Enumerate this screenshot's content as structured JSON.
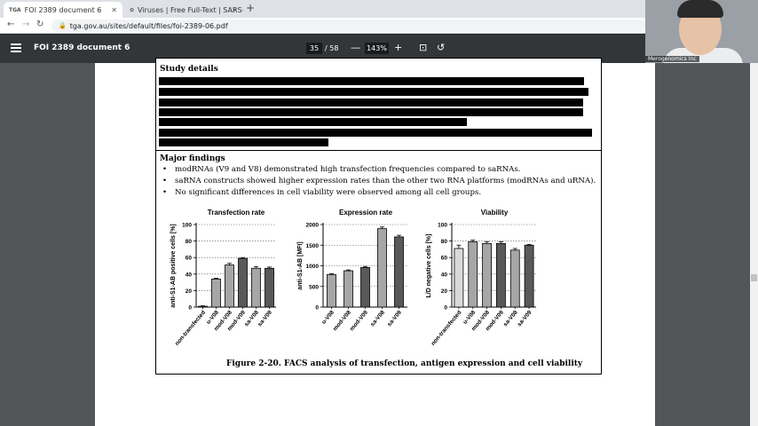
{
  "browser": {
    "tabs": [
      {
        "favicon": "TGA",
        "title": "FOI 2389 document 6",
        "active": true
      },
      {
        "favicon": "virus-icon",
        "title": "Viruses | Free Full-Text | SARS-C...",
        "active": false
      }
    ],
    "url": "tga.gov.au/sites/default/files/foi-2389-06.pdf"
  },
  "pdf_toolbar": {
    "title": "FOI 2389 document 6",
    "page_current": "35",
    "page_total": "/ 58",
    "zoom": "143%",
    "minus": "—",
    "plus": "+"
  },
  "webcam": {
    "label": "Merogenomics Inc"
  },
  "document": {
    "study_details_heading": "Study details",
    "major_findings_heading": "Major findings",
    "findings": [
      "modRNAs (V9 and V8) demonstrated high transfection frequencies compared to saRNAs.",
      "saRNA constructs showed higher expression rates than the other two RNA platforms (modRNAs and uRNA).",
      "No significant differences in cell viability were observed among all cell groups."
    ],
    "caption": "Figure 2-20.  FACS analysis of transfection, antigen expression and cell viability"
  },
  "chart_data": [
    {
      "type": "bar",
      "title": "Transfection rate",
      "ylabel": "anti-S1-AB positive cells [%]",
      "categories": [
        "non-transfected",
        "u-V08",
        "mod-V08",
        "mod-V09",
        "sa-V08",
        "sa-V09"
      ],
      "values": [
        1,
        34,
        51,
        59,
        47,
        47
      ],
      "errors": [
        0.5,
        1,
        2,
        1,
        2,
        1.5
      ],
      "colors": [
        "#d9d9d9",
        "#a6a6a6",
        "#a6a6a6",
        "#595959",
        "#a6a6a6",
        "#595959"
      ],
      "ylim": [
        0,
        100
      ],
      "yticks": [
        0,
        20,
        40,
        60,
        80,
        100
      ],
      "grid": "dotted-horizontal"
    },
    {
      "type": "bar",
      "title": "Expression rate",
      "ylabel": "anti-S1-AB [MFI]",
      "categories": [
        "u-V08",
        "mod-V08",
        "mod-V09",
        "sa-V08",
        "sa-V09"
      ],
      "values": [
        790,
        880,
        960,
        1900,
        1700
      ],
      "errors": [
        20,
        20,
        25,
        40,
        40
      ],
      "colors": [
        "#a6a6a6",
        "#a6a6a6",
        "#595959",
        "#a6a6a6",
        "#595959"
      ],
      "ylim": [
        0,
        2000
      ],
      "yticks": [
        0,
        500,
        1000,
        1500,
        2000
      ],
      "grid": "dotted-horizontal"
    },
    {
      "type": "bar",
      "title": "Viability",
      "ylabel": "L/D negative cells [%]",
      "categories": [
        "non-transfected",
        "u-V08",
        "mod-V08",
        "mod-V09",
        "sa-V08",
        "sa-V09"
      ],
      "values": [
        71,
        79,
        77,
        77,
        69,
        75
      ],
      "errors": [
        4,
        2,
        2,
        2,
        2,
        1
      ],
      "colors": [
        "#d9d9d9",
        "#a6a6a6",
        "#a6a6a6",
        "#595959",
        "#a6a6a6",
        "#595959"
      ],
      "ylim": [
        0,
        100
      ],
      "yticks": [
        0,
        20,
        40,
        60,
        80,
        100
      ],
      "grid": "dotted-horizontal"
    }
  ]
}
